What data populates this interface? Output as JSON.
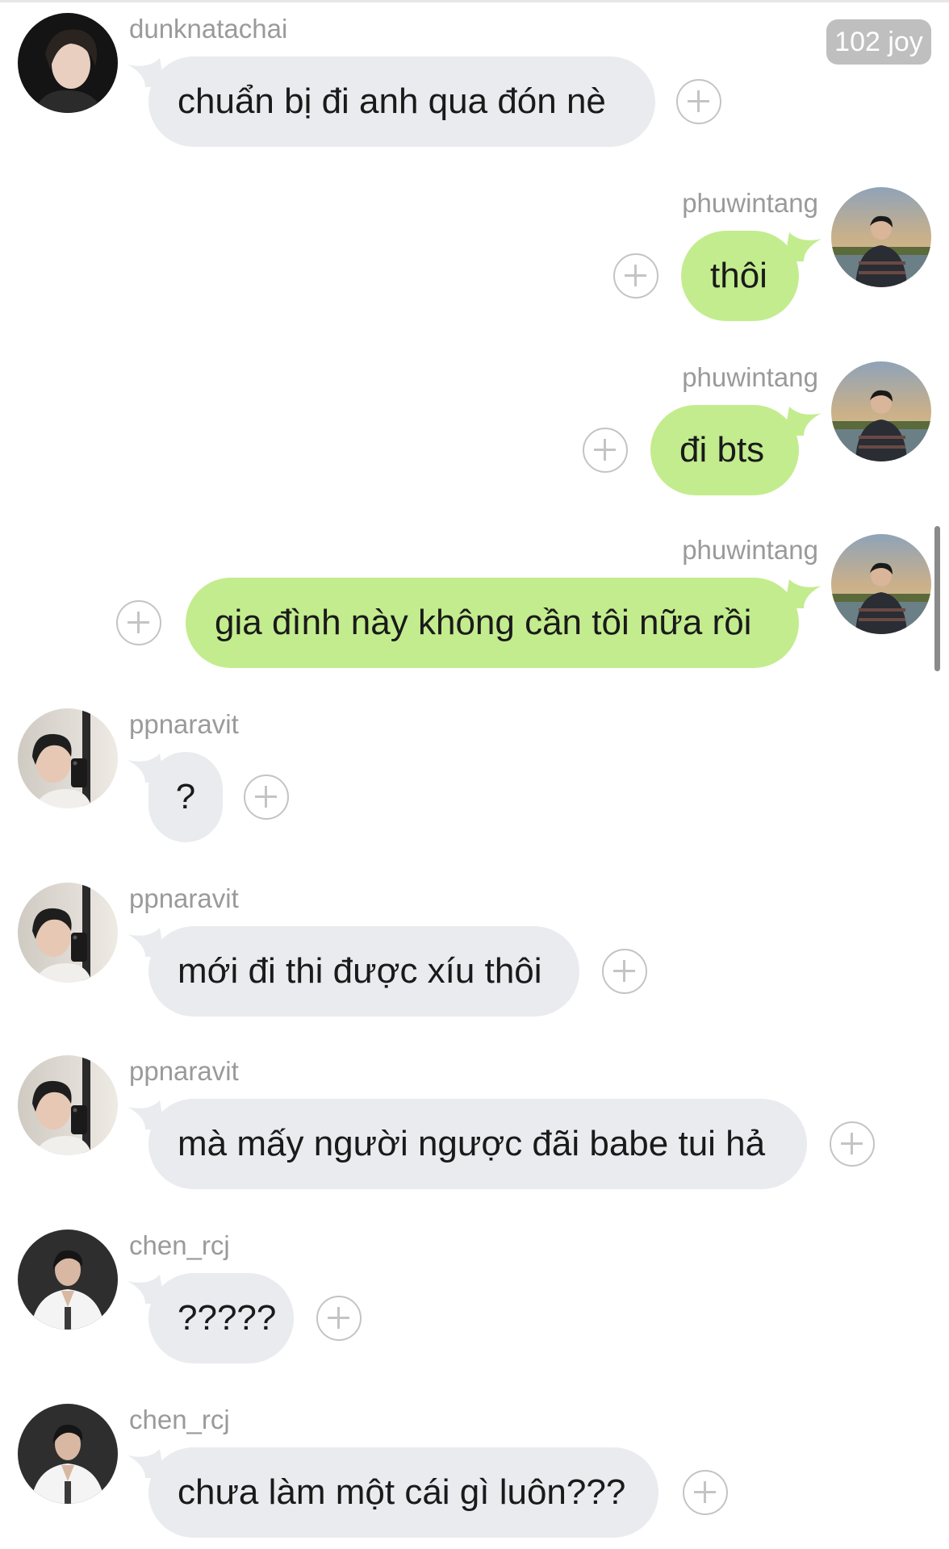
{
  "header": {
    "badge": "102 joy"
  },
  "messages": [
    {
      "user": "dunknatachai",
      "text": "chuẩn bị đi anh qua đón nè",
      "side": "left",
      "avatar": "dunk-avatar"
    },
    {
      "user": "phuwintang",
      "text": "thôi",
      "side": "right",
      "avatar": "phuwin-avatar"
    },
    {
      "user": "phuwintang",
      "text": "đi bts",
      "side": "right",
      "avatar": "phuwin-avatar"
    },
    {
      "user": "phuwintang",
      "text": "gia đình này không cần tôi nữa rồi",
      "side": "right",
      "avatar": "phuwin-avatar"
    },
    {
      "user": "ppnaravit",
      "text": "?",
      "side": "left",
      "avatar": "pond-avatar"
    },
    {
      "user": "ppnaravit",
      "text": "mới đi thi được xíu thôi",
      "side": "left",
      "avatar": "pond-avatar"
    },
    {
      "user": "ppnaravit",
      "text": "mà mấy người ngược đãi babe tui hả",
      "side": "left",
      "avatar": "pond-avatar"
    },
    {
      "user": "chen_rcj",
      "text": "?????",
      "side": "left",
      "avatar": "chen-avatar"
    },
    {
      "user": "chen_rcj",
      "text": "chưa làm một cái gì luôn???",
      "side": "left",
      "avatar": "chen-avatar"
    }
  ],
  "colors": {
    "incoming_bubble": "#e9ebee",
    "outgoing_bubble": "#c3ec8e",
    "username": "#9a9a9a",
    "badge": "#bfbfbf"
  },
  "icons": {
    "react": "plus-circle-icon"
  }
}
